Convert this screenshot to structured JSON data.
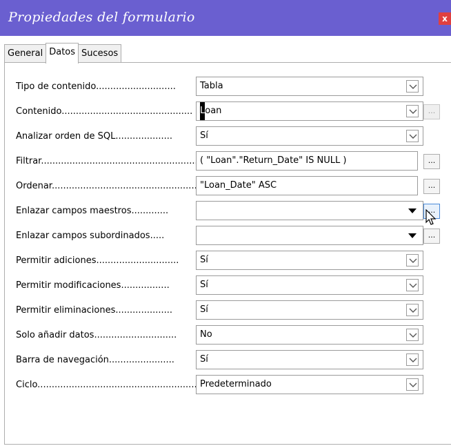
{
  "window": {
    "title": "Propiedades del formulario",
    "close_label": "x"
  },
  "tabs": [
    {
      "label": "General",
      "active": false
    },
    {
      "label": "Datos",
      "active": true
    },
    {
      "label": "Sucesos",
      "active": false
    }
  ],
  "rows": [
    {
      "label": "Tipo de contenido............................",
      "value": "Tabla",
      "control": "dropdown",
      "dots": null
    },
    {
      "label": "Contenido..............................................",
      "value": "Loan",
      "control": "dropdown",
      "dots": "disabled"
    },
    {
      "label": "Analizar orden de SQL....................",
      "value": "Sí",
      "control": "dropdown",
      "dots": null
    },
    {
      "label": "Filtrar..........................................................",
      "value": "( \"Loan\".\"Return_Date\" IS NULL )",
      "control": "text",
      "dots": "enabled"
    },
    {
      "label": "Ordenar.....................................................",
      "value": "\"Loan_Date\" ASC",
      "control": "text",
      "dots": "enabled"
    },
    {
      "label": "Enlazar campos maestros.............",
      "value": "",
      "control": "combo",
      "dots": "hover"
    },
    {
      "label": "Enlazar campos subordinados.....",
      "value": "",
      "control": "combo",
      "dots": "enabled"
    },
    {
      "label": "Permitir adiciones.............................",
      "value": "Sí",
      "control": "dropdown",
      "dots": null
    },
    {
      "label": "Permitir modificaciones.................",
      "value": "Sí",
      "control": "dropdown",
      "dots": null
    },
    {
      "label": "Permitir eliminaciones....................",
      "value": "Sí",
      "control": "dropdown",
      "dots": null
    },
    {
      "label": "Solo añadir datos.............................",
      "value": "No",
      "control": "dropdown",
      "dots": null
    },
    {
      "label": "Barra de navegación.......................",
      "value": "Sí",
      "control": "dropdown",
      "dots": null
    },
    {
      "label": "Ciclo..............................................................",
      "value": "Predeterminado",
      "control": "dropdown",
      "dots": null
    }
  ],
  "dots_label": "...",
  "icons": {
    "dropdown": "chevron-down-icon",
    "combo": "triangle-down-icon",
    "pointer": "mouse-pointer-icon"
  },
  "colors": {
    "titlebar": "#6a5fd0",
    "close": "#e04040"
  }
}
